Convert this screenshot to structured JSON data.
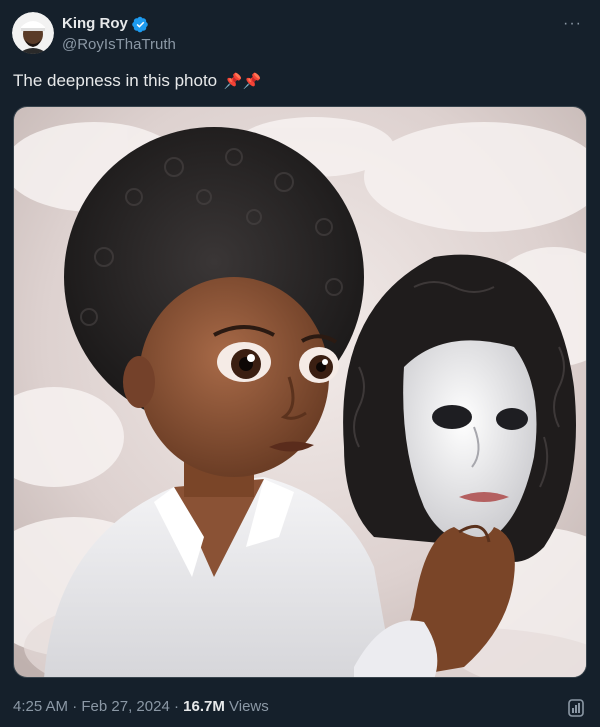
{
  "author": {
    "display_name": "King Roy",
    "handle": "@RoyIsThaTruth",
    "verified_icon": "verified-badge-icon",
    "avatar_icon": "avatar"
  },
  "more_menu": {
    "icon": "more-options-icon",
    "label": "···"
  },
  "tweet": {
    "text": "The deepness in this photo",
    "emoji": "📌📌"
  },
  "media": {
    "icon": "photo"
  },
  "meta": {
    "time": "4:25 AM",
    "separator": " · ",
    "date": "Feb 27, 2024",
    "views_count": "16.7M",
    "views_label": " Views"
  },
  "colors": {
    "background": "#15202b",
    "text": "#e7e9ea",
    "secondary": "#8b98a5",
    "verified": "#1d9bf0"
  }
}
